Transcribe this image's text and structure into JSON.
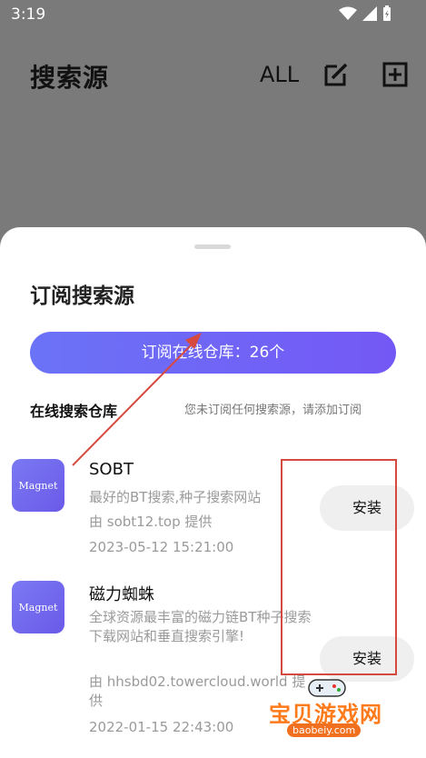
{
  "status_bar": {
    "time": "3:19",
    "icons": [
      "wifi-icon",
      "signal-icon",
      "battery-icon"
    ]
  },
  "app_bar": {
    "title": "搜索源",
    "all_label": "ALL",
    "icons": [
      "edit-icon",
      "add-box-icon"
    ]
  },
  "sheet": {
    "title": "订阅搜索源",
    "subscribe_button": "订阅在线仓库：26个",
    "section_title": "在线搜索仓库",
    "section_hint": "您未订阅任何搜索源，请添加订阅",
    "items": [
      {
        "icon_text": "Magnet",
        "name": "SOBT",
        "description": "最好的BT搜索,种子搜索网站",
        "provider": "由 sobt12.top 提供",
        "date": "2023-05-12 15:21:00",
        "install_label": "安装"
      },
      {
        "icon_text": "Magnet",
        "name": "磁力蜘蛛",
        "description": "全球资源最丰富的磁力链BT种子搜索下载网站和垂直搜索引擎!",
        "provider": "由 hhsbd02.towercloud.world 提供",
        "date": "2022-01-15 22:43:00",
        "install_label": "安装"
      }
    ]
  },
  "watermark": {
    "text": "宝贝游戏网",
    "sub": "baobeiy.com"
  },
  "colors": {
    "accent_gradient_start": "#6b73f7",
    "accent_gradient_end": "#7458f5",
    "annotation_red": "#d6493e",
    "overlay_gray": "#7a7a7a"
  }
}
